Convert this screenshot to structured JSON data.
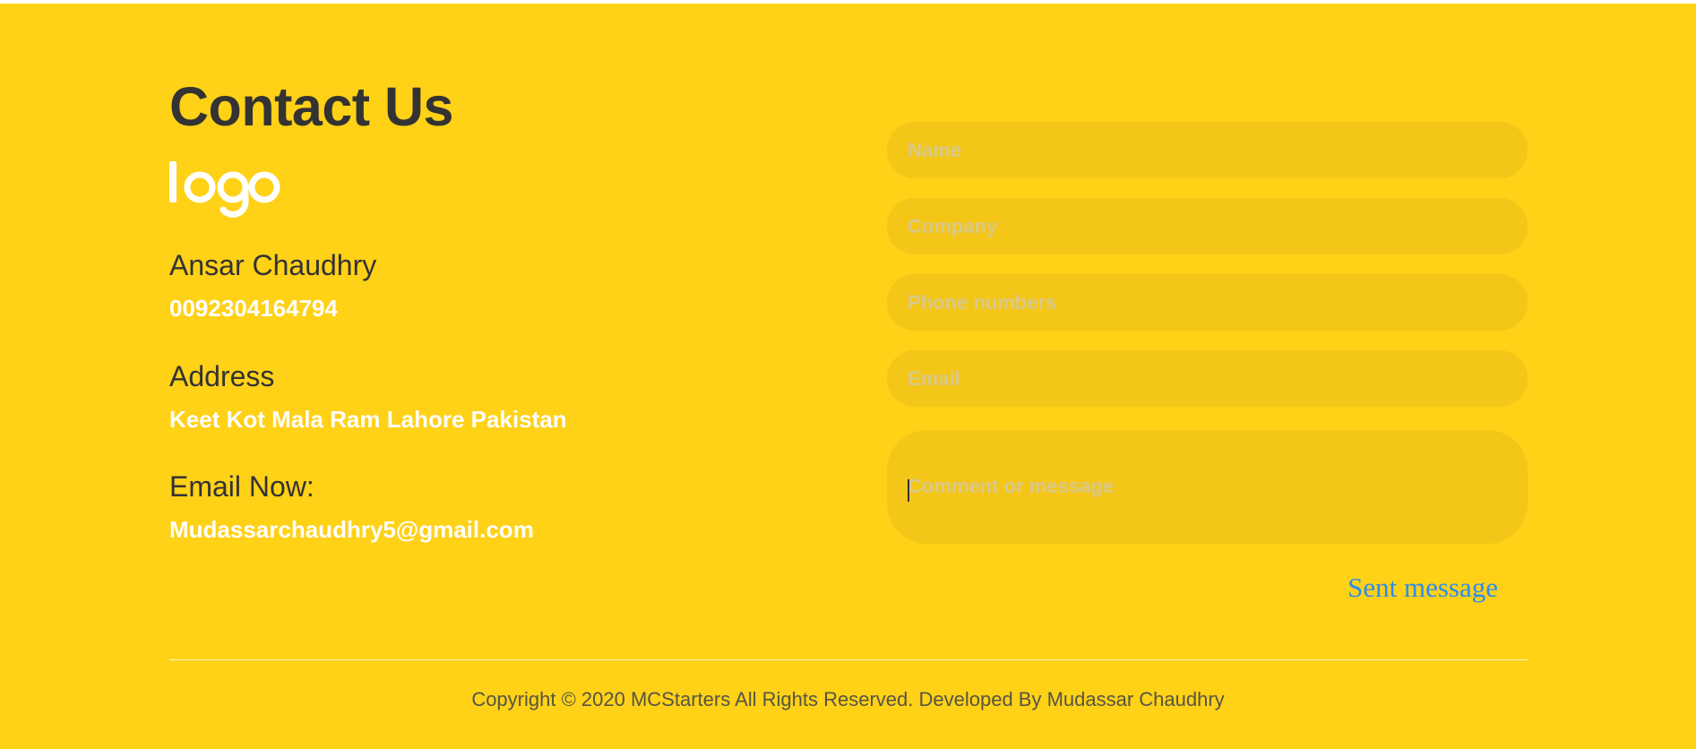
{
  "contact": {
    "title": "Contact Us",
    "logo_text": "logo",
    "name_label": "Ansar Chaudhry",
    "phone": "0092304164794",
    "address_label": "Address",
    "address": "Keet Kot Mala Ram Lahore Pakistan",
    "email_label": "Email Now:",
    "email": "Mudassarchaudhry5@gmail.com"
  },
  "form": {
    "name_placeholder": "Name",
    "company_placeholder": "Company",
    "phone_placeholder": "Phone numbers",
    "email_placeholder": "Email",
    "message_placeholder": "Comment or message",
    "submit_label": "Sent message"
  },
  "footer": {
    "copyright": "Copyright © 2020 MCStarters All Rights Reserved. Developed By Mudassar Chaudhry"
  },
  "colors": {
    "background": "#ffd117",
    "field": "#f3c618",
    "heading_text": "#333333",
    "value_text": "#ffffff",
    "link_blue": "#2c8cf0"
  }
}
